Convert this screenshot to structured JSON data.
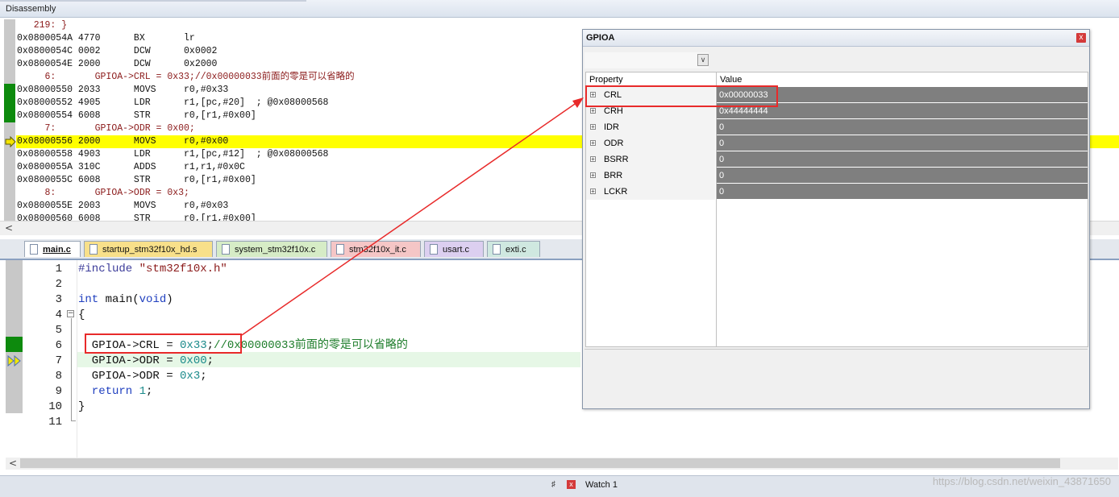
{
  "disassembly": {
    "title": "Disassembly",
    "lines": [
      {
        "text": "   219: }",
        "kind": "src"
      },
      {
        "text": "0x0800054A 4770      BX       lr",
        "kind": "asm"
      },
      {
        "text": "0x0800054C 0002      DCW      0x0002",
        "kind": "asm"
      },
      {
        "text": "0x0800054E 2000      DCW      0x2000",
        "kind": "asm"
      },
      {
        "text": "     6:       GPIOA->CRL = 0x33;//0x00000033前面的零是可以省略的",
        "kind": "src"
      },
      {
        "text": "0x08000550 2033      MOVS     r0,#0x33",
        "kind": "asm",
        "green": true
      },
      {
        "text": "0x08000552 4905      LDR      r1,[pc,#20]  ; @0x08000568",
        "kind": "asm",
        "green": true
      },
      {
        "text": "0x08000554 6008      STR      r0,[r1,#0x00]",
        "kind": "asm",
        "green": true
      },
      {
        "text": "     7:       GPIOA->ODR = 0x00;",
        "kind": "src"
      },
      {
        "text": "0x08000556 2000      MOVS     r0,#0x00",
        "kind": "asm",
        "current": true
      },
      {
        "text": "0x08000558 4903      LDR      r1,[pc,#12]  ; @0x08000568",
        "kind": "asm"
      },
      {
        "text": "0x0800055A 310C      ADDS     r1,r1,#0x0C",
        "kind": "asm"
      },
      {
        "text": "0x0800055C 6008      STR      r0,[r1,#0x00]",
        "kind": "asm"
      },
      {
        "text": "     8:       GPIOA->ODR = 0x3;",
        "kind": "src"
      },
      {
        "text": "0x0800055E 2003      MOVS     r0,#0x03",
        "kind": "asm"
      },
      {
        "text": "0x08000560 6008      STR      r0,[r1,#0x00]",
        "kind": "asm"
      }
    ]
  },
  "tabs": [
    {
      "label": "main.c",
      "color": "#dfe8f6",
      "active": true
    },
    {
      "label": "startup_stm32f10x_hd.s",
      "color": "#f8e08a"
    },
    {
      "label": "system_stm32f10x.c",
      "color": "#d6ecc6"
    },
    {
      "label": "stm32f10x_it.c",
      "color": "#f5c6c6"
    },
    {
      "label": "usart.c",
      "color": "#dccff0"
    },
    {
      "label": "exti.c",
      "color": "#cfe8e0"
    }
  ],
  "editor": {
    "lines": [
      "1",
      "2",
      "3",
      "4",
      "5",
      "6",
      "7",
      "8",
      "9",
      "10",
      "11"
    ],
    "code": {
      "l1_pp": "#include",
      "l1_str": " \"stm32f10x.h\"",
      "l3_kw1": "int",
      "l3_mid": " main(",
      "l3_kw2": "void",
      "l3_end": ")",
      "l4": "{",
      "l6_a": "  GPIOA->CRL = ",
      "l6_num": "0x33",
      "l6_b": ";",
      "l6_cmt": "//0x00000033前面的零是可以省略的",
      "l7_a": "  GPIOA->ODR = ",
      "l7_num": "0x00",
      "l7_b": ";",
      "l8_a": "  GPIOA->ODR = ",
      "l8_num": "0x3",
      "l8_b": ";",
      "l9_kw": "  return",
      "l9_num": " 1",
      "l9_b": ";",
      "l10": "}"
    }
  },
  "gpioa": {
    "title": "GPIOA",
    "close": "x",
    "combo_arrow": "∨",
    "col_property": "Property",
    "col_value": "Value",
    "rows": [
      {
        "name": "CRL",
        "value": "0x00000033"
      },
      {
        "name": "CRH",
        "value": "0x44444444"
      },
      {
        "name": "IDR",
        "value": "0"
      },
      {
        "name": "ODR",
        "value": "0"
      },
      {
        "name": "BSRR",
        "value": "0"
      },
      {
        "name": "BRR",
        "value": "0"
      },
      {
        "name": "LCKR",
        "value": "0"
      }
    ],
    "expand_glyph": "+"
  },
  "bottom": {
    "watch_label": "Watch 1",
    "pin": "♯",
    "close": "x",
    "watermark": "https://blog.csdn.net/weixin_43871650"
  },
  "scroll": {
    "left_arrow": "<"
  }
}
